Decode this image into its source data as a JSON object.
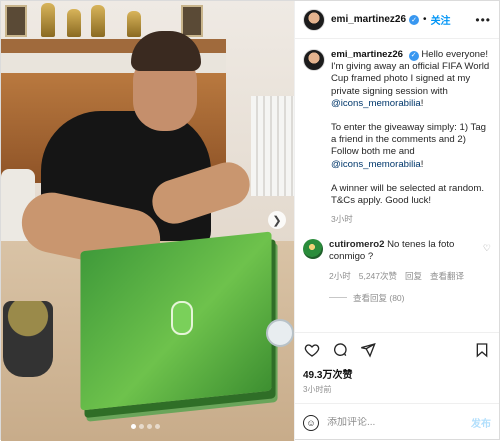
{
  "header": {
    "username": "emi_martinez26",
    "follow_label": "关注",
    "more_icon": "more-horizontal-icon"
  },
  "caption": {
    "username": "emi_martinez26",
    "line1": "Hello everyone! I'm giving away an official FIFA World Cup framed photo I signed at my private signing session with",
    "mention": "@icons_memorabilia",
    "line1_end": "!",
    "para2_start": "To enter the giveaway simply: 1) Tag a friend in the comments and 2) Follow both me and",
    "para2_end": "!",
    "para3": "A winner will be selected at random. T&Cs apply. Good luck!",
    "time": "3小时"
  },
  "comment": {
    "username": "cutiromero2",
    "text": "No tenes la foto conmigo ?",
    "time": "2小时",
    "likes": "5,247次赞",
    "reply_label": "回复",
    "translate_label": "查看翻译",
    "view_replies": "查看回复 (80)"
  },
  "actions": {
    "like_icon": "heart-icon",
    "comment_icon": "comment-icon",
    "share_icon": "send-icon",
    "save_icon": "bookmark-icon"
  },
  "likes": "49.3万次赞",
  "post_time": "3小时前",
  "add_comment": {
    "placeholder": "添加评论...",
    "post_label": "发布"
  },
  "carousel": {
    "slides": 4,
    "active_index": 0
  },
  "colors": {
    "link": "#0095f6",
    "mention": "#00376b",
    "verified": "#3897f0",
    "muted": "#8e8e8e"
  }
}
